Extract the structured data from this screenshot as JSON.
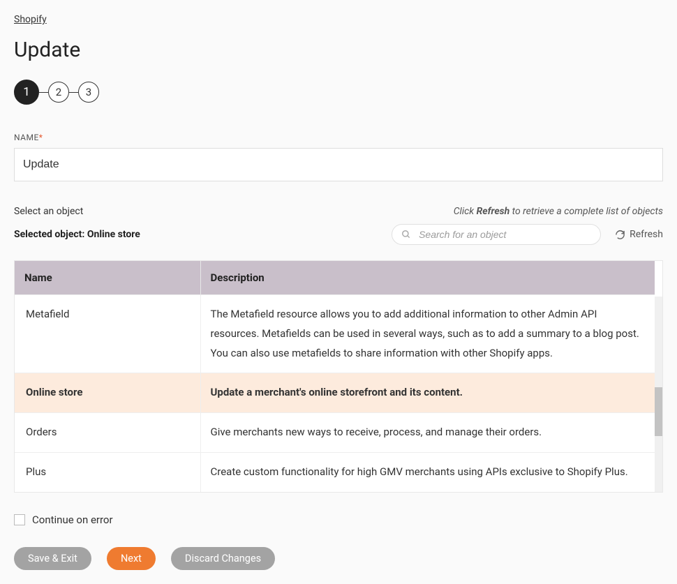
{
  "breadcrumb": "Shopify",
  "page_title": "Update",
  "steps": [
    "1",
    "2",
    "3"
  ],
  "name_field": {
    "label": "NAME",
    "value": "Update"
  },
  "object_select": {
    "label": "Select an object",
    "hint_prefix": "Click ",
    "hint_bold": "Refresh",
    "hint_suffix": " to retrieve a complete list of objects",
    "selected_prefix": "Selected object: ",
    "selected_value": "Online store",
    "search_placeholder": "Search for an object",
    "refresh_label": "Refresh"
  },
  "table": {
    "headers": {
      "name": "Name",
      "description": "Description"
    },
    "rows": [
      {
        "name": "Metafield",
        "description": "The Metafield resource allows you to add additional information to other Admin API resources. Metafields can be used in several ways, such as to add a summary to a blog post. You can also use metafields to share information with other Shopify apps.",
        "selected": false
      },
      {
        "name": "Online store",
        "description": "Update a merchant's online storefront and its content.",
        "selected": true
      },
      {
        "name": "Orders",
        "description": "Give merchants new ways to receive, process, and manage their orders.",
        "selected": false
      },
      {
        "name": "Plus",
        "description": "Create custom functionality for high GMV merchants using APIs exclusive to Shopify Plus.",
        "selected": false
      }
    ]
  },
  "continue_on_error_label": "Continue on error",
  "buttons": {
    "save_exit": "Save & Exit",
    "next": "Next",
    "discard": "Discard Changes"
  }
}
